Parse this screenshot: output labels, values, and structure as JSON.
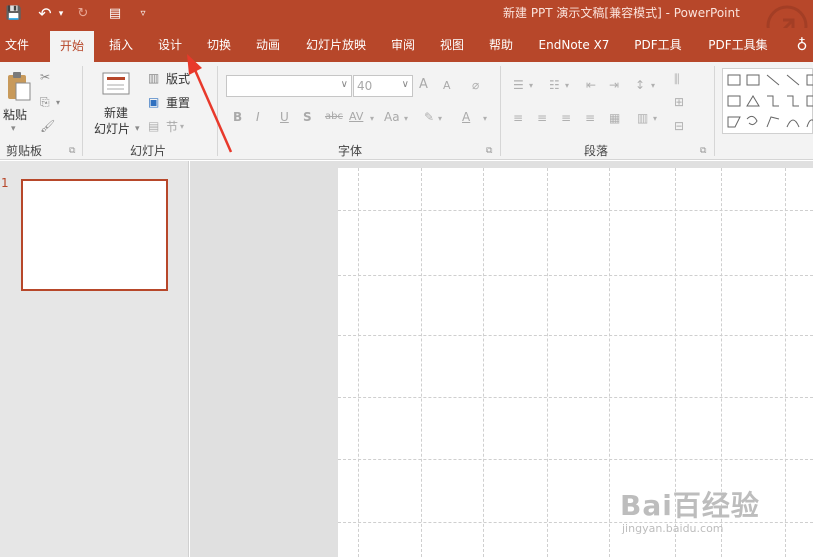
{
  "titlebar": {
    "title": "新建 PPT 演示文稿[兼容模式] - PowerPoint",
    "save_icon": "💾",
    "undo_icon": "↶",
    "redo_icon": "↻",
    "customize_icon": "▿"
  },
  "tabs": [
    {
      "label": "文件"
    },
    {
      "label": "开始"
    },
    {
      "label": "插入"
    },
    {
      "label": "设计"
    },
    {
      "label": "切换"
    },
    {
      "label": "动画"
    },
    {
      "label": "幻灯片放映"
    },
    {
      "label": "审阅"
    },
    {
      "label": "视图"
    },
    {
      "label": "帮助"
    },
    {
      "label": "EndNote X7"
    },
    {
      "label": "PDF工具"
    },
    {
      "label": "PDF工具集"
    }
  ],
  "tell_me_icon": "lightbulb-icon",
  "ribbon": {
    "clipboard": {
      "paste": "粘贴",
      "group": "剪贴板"
    },
    "slides": {
      "new_slide_line1": "新建",
      "new_slide_line2": "幻灯片",
      "layout": "版式",
      "reset": "重置",
      "section": "节",
      "group": "幻灯片"
    },
    "font": {
      "size": "40",
      "bold": "B",
      "italic": "I",
      "underline": "U",
      "shadow": "S",
      "strike": "abc",
      "spacing": "AV",
      "case": "Aa",
      "color": "A",
      "grow": "A",
      "shrink": "A",
      "group": "字体"
    },
    "paragraph": {
      "group": "段落"
    }
  },
  "thumbnails": [
    {
      "number": "1"
    }
  ],
  "watermark": {
    "logo": "Bai百经验",
    "url": "jingyan.baidu.com"
  },
  "colors": {
    "accent": "#b7472a",
    "ribbon_bg": "#f3f3f3",
    "pane_bg": "#e6e6e6",
    "annotation": "#e8392b"
  }
}
